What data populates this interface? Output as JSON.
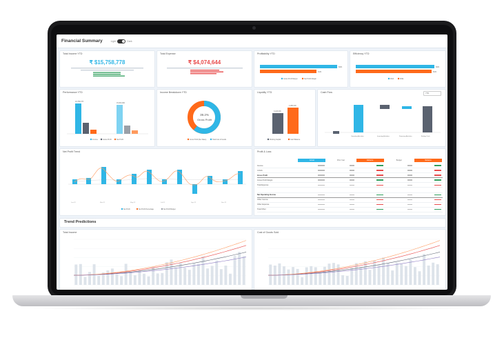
{
  "app": {
    "title": "Financial Summary",
    "toggle_left": "Light",
    "toggle_right": "Dark"
  },
  "colors": {
    "blue": "#2fb6e6",
    "orange": "#ff6a1a",
    "gray": "#5a6270",
    "green": "#2e9e5b",
    "red": "#e84b4b"
  },
  "kpis": [
    {
      "title": "Total Income YTD",
      "value": "₹ $15,758,778",
      "color": "#2fb6e6"
    },
    {
      "title": "Total Expense",
      "value": "₹ $4,074,644",
      "color": "#e84b4b"
    }
  ],
  "profitability": {
    "title": "Profitability YTD",
    "bars": [
      {
        "label": "Gross Profit Margin",
        "value": 0.84
      },
      {
        "label": "Net Profit Margin",
        "value": 0.61
      }
    ]
  },
  "efficiency": {
    "title": "Efficiency YTD",
    "bars": [
      {
        "label": "ROA",
        "value": 0.84
      },
      {
        "label": "ROE",
        "value": 0.81
      }
    ]
  },
  "performance": {
    "title": "Performance YTD",
    "legend": [
      "Income",
      "Gross Profit",
      "Net Profit"
    ]
  },
  "income_breakdown": {
    "title": "Income Breakdown YTD",
    "center_value": "39.2%",
    "center_label": "Gross Profit",
    "gross_profit_pct": 39.2,
    "legend": [
      "Gross Profit (Net Sales)",
      "Total Cost of Goods"
    ]
  },
  "liquidity": {
    "title": "Liquidity YTD",
    "legend": [
      "Working Capital",
      "Cash Balance"
    ]
  },
  "cash_flow": {
    "title": "Cash Flow",
    "dropdown": "YTD"
  },
  "net_profit_trend": {
    "title": "Net Profit Trend",
    "legend": [
      "Net Profit",
      "Net Profit Percentage",
      "Net Profit Budget"
    ]
  },
  "profit_losses": {
    "title": "Profit & Loss",
    "headers": [
      "Actual",
      "Prior Year",
      "Variance",
      "Budget",
      "Variance"
    ],
    "rows": [
      "Income",
      "COGS",
      "Gross Profit",
      "Gross Profit Margin",
      "Total Expense",
      "",
      "Net Operating Income",
      "Other Income",
      "Other Expense",
      "Total Other",
      "",
      "Net Profit",
      "Net Profit Margin"
    ]
  },
  "trend": {
    "title": "Trend Predictions",
    "left_title": "Total Income",
    "right_title": "Cost of Goods Sold"
  }
}
